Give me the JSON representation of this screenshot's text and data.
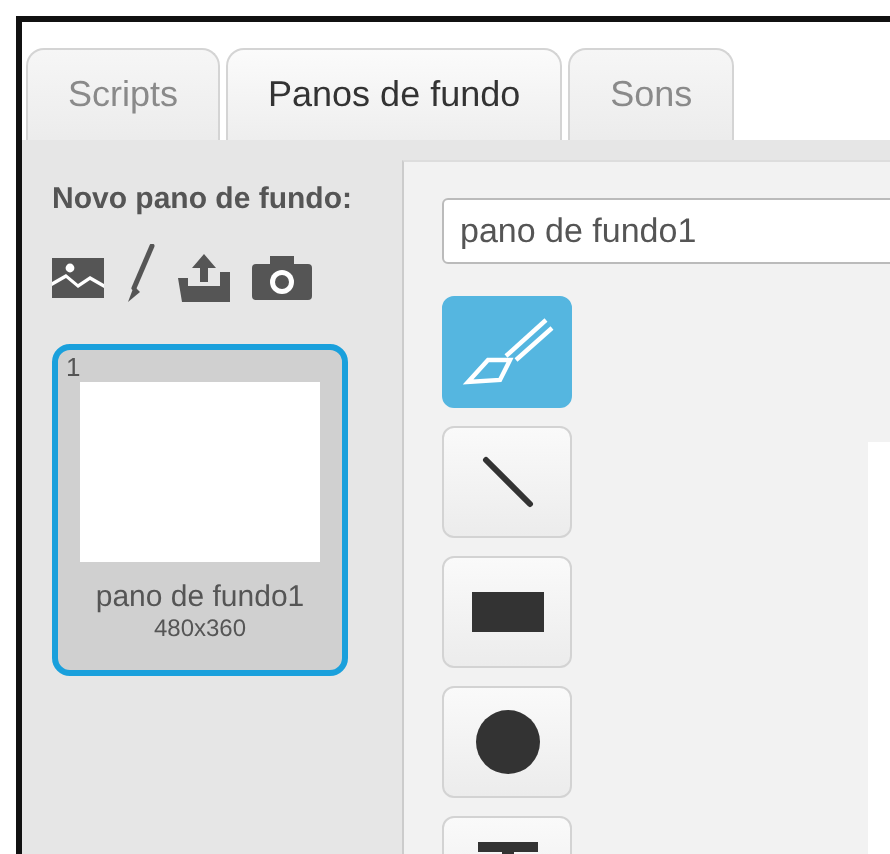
{
  "tabs": [
    {
      "label": "Scripts",
      "selected": false
    },
    {
      "label": "Panos de fundo",
      "selected": true
    },
    {
      "label": "Sons",
      "selected": false
    }
  ],
  "new_backdrop": {
    "label": "Novo pano de fundo:",
    "sources": [
      {
        "kind": "library"
      },
      {
        "kind": "paint"
      },
      {
        "kind": "upload"
      },
      {
        "kind": "camera"
      }
    ]
  },
  "backdrops": [
    {
      "number": "1",
      "name": "pano de fundo1",
      "size": "480x360",
      "selected": true
    }
  ],
  "name_field": {
    "value": "pano de fundo1"
  },
  "tools": [
    {
      "kind": "brush",
      "selected": true
    },
    {
      "kind": "line",
      "selected": false
    },
    {
      "kind": "rectangle",
      "selected": false
    },
    {
      "kind": "ellipse",
      "selected": false
    },
    {
      "kind": "text",
      "selected": false
    }
  ]
}
